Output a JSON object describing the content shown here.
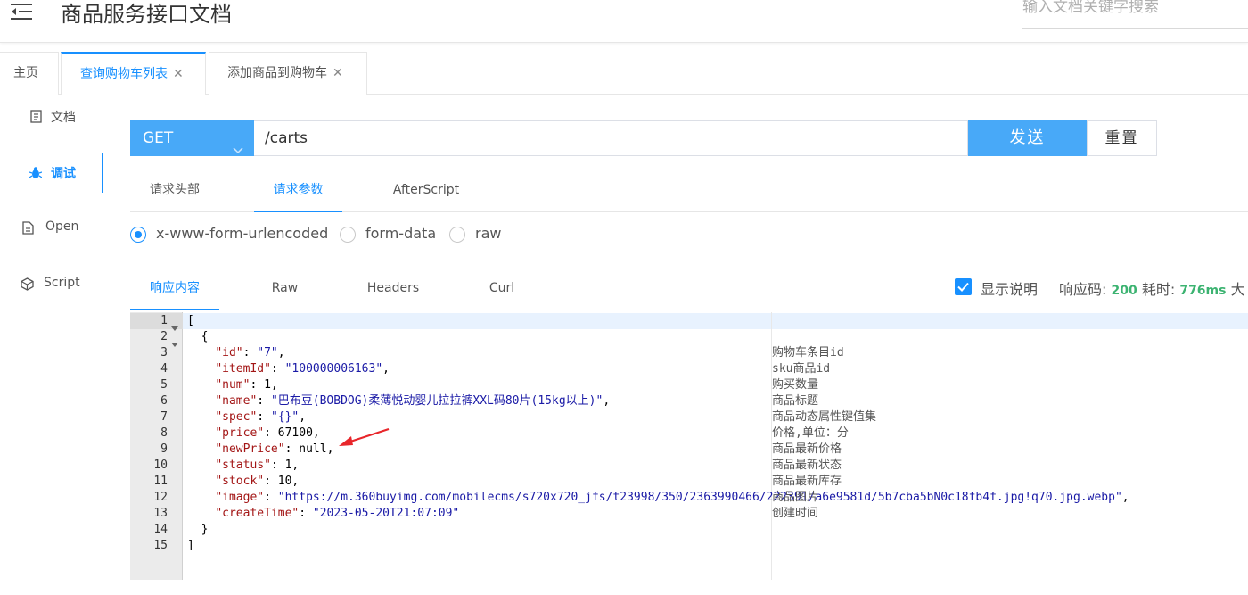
{
  "header": {
    "title": "商品服务接口文档",
    "search_placeholder": "输入文档关键字搜索"
  },
  "tabs": [
    {
      "label": "主页"
    },
    {
      "label": "查询购物车列表",
      "close": "✕"
    },
    {
      "label": "添加商品到购物车",
      "close": "✕"
    }
  ],
  "sidebar": {
    "items": [
      {
        "label": "文档",
        "icon": "document-icon"
      },
      {
        "label": "调试",
        "icon": "bug-icon"
      },
      {
        "label": "Open",
        "icon": "file-icon"
      },
      {
        "label": "Script",
        "icon": "cube-icon"
      }
    ]
  },
  "request": {
    "method": "GET",
    "url": "/carts",
    "send_label": "发送",
    "reset_label": "重置"
  },
  "request_tabs": [
    {
      "label": "请求头部"
    },
    {
      "label": "请求参数"
    },
    {
      "label": "AfterScript"
    }
  ],
  "body_types": [
    {
      "label": "x-www-form-urlencoded",
      "checked": true
    },
    {
      "label": "form-data",
      "checked": false
    },
    {
      "label": "raw",
      "checked": false
    }
  ],
  "response_tabs": [
    {
      "label": "响应内容"
    },
    {
      "label": "Raw"
    },
    {
      "label": "Headers"
    },
    {
      "label": "Curl"
    }
  ],
  "response_meta": {
    "show_desc_label": "显示说明",
    "show_desc_checked": true,
    "code_label": "响应码:",
    "code": "200",
    "time_label": "耗时:",
    "time": "776ms",
    "size_label": "大"
  },
  "editor": {
    "lines": [
      {
        "n": "1",
        "fold": true,
        "parts": [
          [
            "p",
            "["
          ]
        ]
      },
      {
        "n": "2",
        "fold": true,
        "parts": [
          [
            "p",
            "  {"
          ]
        ]
      },
      {
        "n": "3",
        "parts": [
          [
            "p",
            "    "
          ],
          [
            "k",
            "\"id\""
          ],
          [
            "p",
            ": "
          ],
          [
            "s",
            "\"7\""
          ],
          [
            "p",
            ","
          ]
        ],
        "desc": "购物车条目id"
      },
      {
        "n": "4",
        "parts": [
          [
            "p",
            "    "
          ],
          [
            "k",
            "\"itemId\""
          ],
          [
            "p",
            ": "
          ],
          [
            "s",
            "\"100000006163\""
          ],
          [
            "p",
            ","
          ]
        ],
        "desc": "sku商品id"
      },
      {
        "n": "5",
        "parts": [
          [
            "p",
            "    "
          ],
          [
            "k",
            "\"num\""
          ],
          [
            "p",
            ": "
          ],
          [
            "v",
            "1"
          ],
          [
            "p",
            ","
          ]
        ],
        "desc": "购买数量"
      },
      {
        "n": "6",
        "parts": [
          [
            "p",
            "    "
          ],
          [
            "k",
            "\"name\""
          ],
          [
            "p",
            ": "
          ],
          [
            "s",
            "\"巴布豆(BOBDOG)柔薄悦动婴儿拉拉裤XXL码80片(15kg以上)\""
          ],
          [
            "p",
            ","
          ]
        ],
        "desc": "商品标题"
      },
      {
        "n": "7",
        "parts": [
          [
            "p",
            "    "
          ],
          [
            "k",
            "\"spec\""
          ],
          [
            "p",
            ": "
          ],
          [
            "s",
            "\"{}\""
          ],
          [
            "p",
            ","
          ]
        ],
        "desc": "商品动态属性键值集"
      },
      {
        "n": "8",
        "parts": [
          [
            "p",
            "    "
          ],
          [
            "k",
            "\"price\""
          ],
          [
            "p",
            ": "
          ],
          [
            "v",
            "67100"
          ],
          [
            "p",
            ","
          ]
        ],
        "desc": "价格,单位：分"
      },
      {
        "n": "9",
        "parts": [
          [
            "p",
            "    "
          ],
          [
            "k",
            "\"newPrice\""
          ],
          [
            "p",
            ": "
          ],
          [
            "v",
            "null"
          ],
          [
            "p",
            ","
          ]
        ],
        "desc": "商品最新价格"
      },
      {
        "n": "10",
        "parts": [
          [
            "p",
            "    "
          ],
          [
            "k",
            "\"status\""
          ],
          [
            "p",
            ": "
          ],
          [
            "v",
            "1"
          ],
          [
            "p",
            ","
          ]
        ],
        "desc": "商品最新状态"
      },
      {
        "n": "11",
        "parts": [
          [
            "p",
            "    "
          ],
          [
            "k",
            "\"stock\""
          ],
          [
            "p",
            ": "
          ],
          [
            "v",
            "10"
          ],
          [
            "p",
            ","
          ]
        ],
        "desc": "商品最新库存"
      },
      {
        "n": "12",
        "parts": [
          [
            "p",
            "    "
          ],
          [
            "k",
            "\"image\""
          ],
          [
            "p",
            ": "
          ],
          [
            "s",
            "\"https://m.360buyimg.com/mobilecms/s720x720_jfs/t23998/350/2363990466/222391/a6e9581d/5b7cba5bN0c18fb4f.jpg!q70.jpg.webp\""
          ],
          [
            "p",
            ","
          ]
        ],
        "desc": "商品图片"
      },
      {
        "n": "13",
        "parts": [
          [
            "p",
            "    "
          ],
          [
            "k",
            "\"createTime\""
          ],
          [
            "p",
            ": "
          ],
          [
            "s",
            "\"2023-05-20T21:07:09\""
          ]
        ],
        "desc": "创建时间"
      },
      {
        "n": "14",
        "parts": [
          [
            "p",
            "  }"
          ]
        ]
      },
      {
        "n": "15",
        "parts": [
          [
            "p",
            "]"
          ]
        ]
      }
    ]
  },
  "colors": {
    "accent": "#1890ff",
    "button": "#48a9f8",
    "success": "#3cb371",
    "annotation_arrow": "#e8262b"
  }
}
